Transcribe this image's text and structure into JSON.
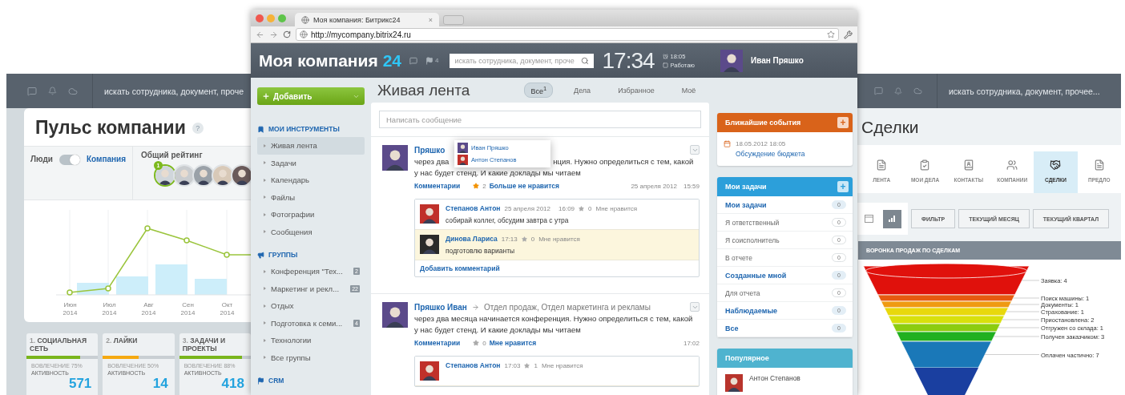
{
  "left_panel": {
    "search": {
      "value": "искать сотрудника, документ, проче"
    },
    "title": "Пульс компании",
    "help": "?",
    "toggle": {
      "left_label": "Люди",
      "right_label": "Компания",
      "on": true
    },
    "rating": {
      "label": "Общий рейтинг",
      "badge": "1",
      "avatars": [
        {
          "selected": true
        },
        {
          "selected": false
        },
        {
          "selected": false
        },
        {
          "selected": false
        },
        {
          "selected": false
        }
      ]
    },
    "chart": {
      "labels": [
        {
          "month": "Июн",
          "year": "2014"
        },
        {
          "month": "Июл",
          "year": "2014"
        },
        {
          "month": "Авг",
          "year": "2014"
        },
        {
          "month": "Сен",
          "year": "2014"
        },
        {
          "month": "Окт",
          "year": "2014"
        }
      ]
    },
    "cards": [
      {
        "number": "1.",
        "title": "СОЦИАЛЬНАЯ СЕТЬ",
        "level": 0.75,
        "color": "#79b51c",
        "engagement": "ВОВЛЕЧЕНИЕ 75%",
        "activity": "АКТИВНОСТЬ",
        "value": "571"
      },
      {
        "number": "2.",
        "title": "ЛАЙКИ",
        "level": 0.5,
        "color": "#f5a911",
        "engagement": "ВОВЛЕЧЕНИЕ 50%",
        "activity": "АКТИВНОСТЬ",
        "value": "14"
      },
      {
        "number": "3.",
        "title": "ЗАДАЧИ И ПРОЕКТЫ",
        "level": 0.88,
        "color": "#79b51c",
        "engagement": "ВОВЛЕЧЕНИЕ 88%",
        "activity": "АКТИВНОСТЬ",
        "value": "418"
      }
    ]
  },
  "browser": {
    "tab_title": "Моя компания: Битрикс24",
    "tab_close": "×",
    "url": "http://mycompany.bitrix24.ru"
  },
  "header": {
    "company": "Моя компания",
    "company_suffix": "24",
    "notifications": "4",
    "search": {
      "value": "искать сотрудника, документ, проче"
    },
    "clock": "17:34",
    "alarm": "18:05",
    "status": "Работаю",
    "user": "Иван Пряшко"
  },
  "sidebar": {
    "add_button": "Добавить",
    "sections": [
      {
        "kind": "tools",
        "title": "МОИ ИНСТРУМЕНТЫ",
        "items": [
          {
            "label": "Живая лента",
            "selected": true
          },
          {
            "label": "Задачи",
            "selected": false
          },
          {
            "label": "Календарь",
            "selected": false
          },
          {
            "label": "Файлы",
            "selected": false
          },
          {
            "label": "Фотографии",
            "selected": false
          },
          {
            "label": "Сообщения",
            "selected": false
          }
        ]
      },
      {
        "kind": "groups",
        "title": "ГРУППЫ",
        "items": [
          {
            "label": "Конференция \"Тех...",
            "count": "2",
            "selected": false
          },
          {
            "label": "Маркетинг и рекл...",
            "count": "22",
            "selected": false
          },
          {
            "label": "Отдых",
            "selected": false
          },
          {
            "label": "Подготовка к семи...",
            "count": "4",
            "selected": false
          },
          {
            "label": "Технологии",
            "selected": false
          },
          {
            "label": "Все группы",
            "selected": false
          }
        ]
      },
      {
        "kind": "crm",
        "title": "CRM"
      }
    ]
  },
  "feed": {
    "title": "Живая лента",
    "filters": [
      {
        "label": "Все",
        "count": "1",
        "selected": true
      },
      {
        "label": "Дела",
        "selected": false
      },
      {
        "label": "Избранное",
        "selected": false
      },
      {
        "label": "Моё",
        "selected": false
      }
    ],
    "composer": {
      "placeholder": "Написать сообщение"
    },
    "posts": [
      {
        "author": "Пряшко",
        "popup": [
          "Иван Пряшко",
          "Антон Степанов"
        ],
        "lines": [
          [
            "через два",
            "нция. Нужно определиться с тем, какой"
          ],
          [
            "у нас будет стенд. И какие доклады мы читаем"
          ]
        ],
        "comments_link": "Комментарии",
        "likes": {
          "count": "2",
          "label": "Больше не нравится",
          "liked": true
        },
        "date": "25 апреля 2012",
        "time": "15:59",
        "comments": [
          {
            "author": "Степанов Антон",
            "date": "25 апреля 2012",
            "time": "16:09",
            "likes": "0",
            "like_label": "Мне нравится",
            "text": "собирай коллег, обсудим завтра с утра",
            "highlighted": false
          },
          {
            "author": "Динова Лариса",
            "time": "17:13",
            "likes": "0",
            "like_label": "Мне нравится",
            "text": "подготовлю варианты",
            "highlighted": true
          }
        ],
        "add_comment": "Добавить комментарий"
      },
      {
        "author": "Пряшко Иван",
        "recipients": "Отдел продаж, Отдел маркетинга и рекламы",
        "lines": [
          [
            "через два месяца начинается конференция. Нужно определиться с тем, какой"
          ],
          [
            "у нас будет стенд. И какие доклады мы читаем"
          ]
        ],
        "comments_link": "Комментарии",
        "likes": {
          "count": "0",
          "label": "Мне нравится",
          "liked": false
        },
        "time": "17:02",
        "comments": [
          {
            "author": "Степанов Антон",
            "time": "17:03",
            "likes": "1",
            "like_label": "Мне нравится",
            "highlighted": false
          }
        ]
      }
    ]
  },
  "widgets": [
    {
      "kind": "events",
      "title": "Ближайшие события",
      "color": "#d9631a",
      "add": "+",
      "date": "18.05.2012 18:05",
      "event": "Обсуждение бюджета"
    },
    {
      "kind": "tasks",
      "title": "Мои задачи",
      "color": "#2c9fda",
      "add": "+",
      "rows": [
        {
          "label": "Мои задачи",
          "count": "0",
          "kind": "group"
        },
        {
          "label": "Я ответственный",
          "count": "0",
          "kind": "item"
        },
        {
          "label": "Я соисполнитель",
          "count": "0",
          "kind": "item"
        },
        {
          "label": "В отчете",
          "count": "0",
          "kind": "item"
        },
        {
          "label": "Созданные мной",
          "count": "0",
          "kind": "group"
        },
        {
          "label": "Для отчета",
          "count": "0",
          "kind": "item"
        },
        {
          "label": "Наблюдаемые",
          "count": "0",
          "kind": "group"
        },
        {
          "label": "Все",
          "count": "0",
          "kind": "group"
        }
      ]
    },
    {
      "kind": "popular",
      "title": "Популярное",
      "color": "#4fb3cf",
      "person": "Антон Степанов"
    }
  ],
  "right_panel": {
    "search": {
      "value": "искать сотрудника, документ, прочее..."
    },
    "title": "Сделки",
    "nav": [
      {
        "kind": "feed",
        "label": "ЛЕНТА",
        "selected": false
      },
      {
        "kind": "tasks",
        "label": "МОИ ДЕЛА",
        "selected": false
      },
      {
        "kind": "contacts",
        "label": "КОНТАКТЫ",
        "selected": false
      },
      {
        "kind": "companies",
        "label": "КОМПАНИИ",
        "selected": false
      },
      {
        "kind": "deals",
        "label": "СДЕЛКИ",
        "selected": true
      },
      {
        "kind": "proposals",
        "label": "ПРЕДЛО",
        "selected": false
      }
    ],
    "views": [
      {
        "kind": "list",
        "selected": false
      },
      {
        "kind": "chart",
        "selected": true
      }
    ],
    "buttons": [
      "ФИЛЬТР",
      "ТЕКУЩИЙ МЕСЯЦ",
      "ТЕКУЩИЙ КВАРТАЛ"
    ],
    "funnel": {
      "title": "ВОРОНКА ПРОДАЖ ПО СДЕЛКАМ",
      "stages": [
        {
          "label": "Заявка: 4",
          "color": "#e0110c"
        },
        {
          "label": "Поиск машины: 1",
          "color": "#e65a10"
        },
        {
          "label": "Документы: 1",
          "color": "#ef9a12"
        },
        {
          "label": "Страхование: 1",
          "color": "#e8d80c"
        },
        {
          "label": "Приостановлена: 2",
          "color": "#d8e00c"
        },
        {
          "label": "Отгружен со склада: 1",
          "color": "#8ccc10"
        },
        {
          "label": "Получен заказчиком: 3",
          "color": "#20b020"
        },
        {
          "label": "Оплачен частично: 7",
          "color": "#1a78b8"
        }
      ]
    }
  }
}
